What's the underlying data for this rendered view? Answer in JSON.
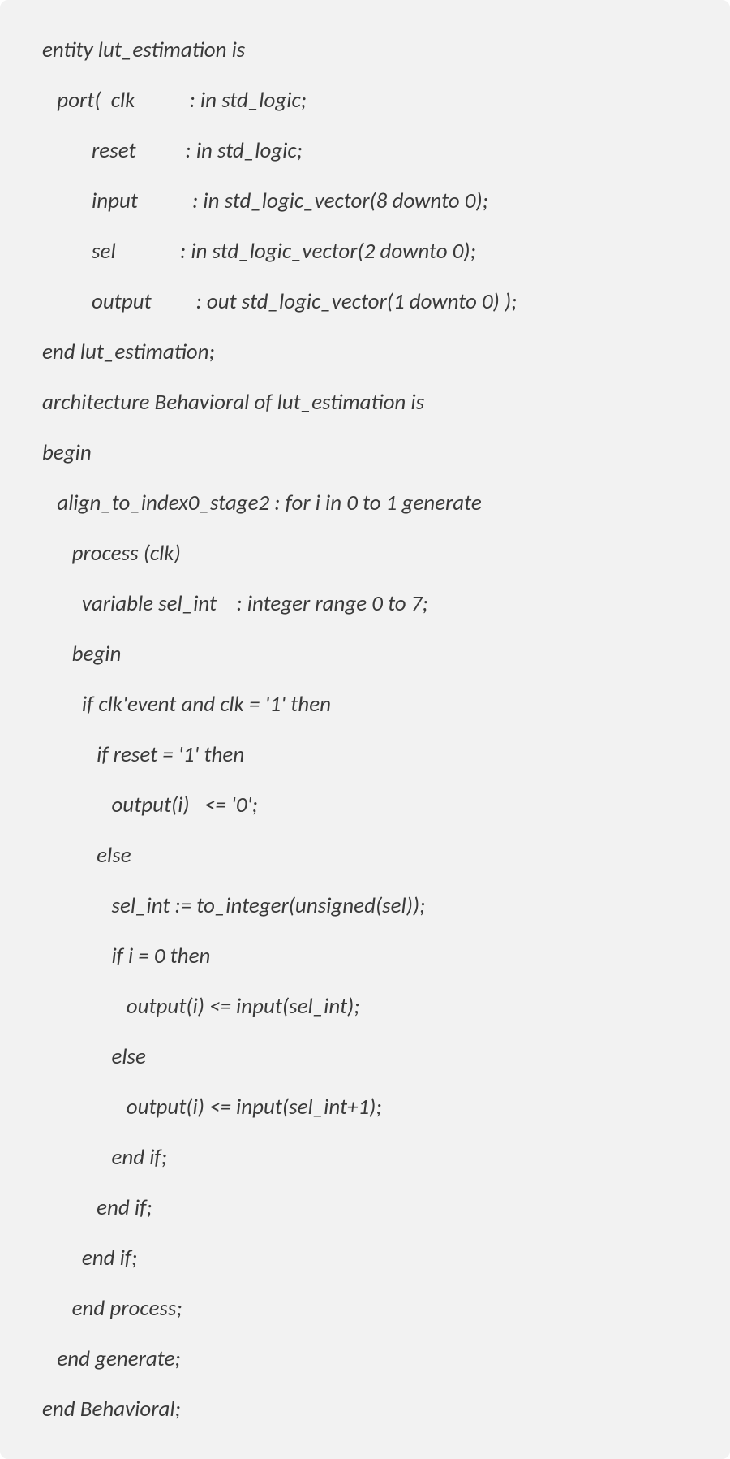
{
  "code": {
    "lines": [
      "entity lut_estimation is",
      "   port(  clk           : in std_logic;",
      "          reset          : in std_logic;",
      "          input           : in std_logic_vector(8 downto 0);",
      "          sel             : in std_logic_vector(2 downto 0);",
      "          output         : out std_logic_vector(1 downto 0) );",
      "end lut_estimation;",
      "architecture Behavioral of lut_estimation is",
      "begin",
      "   align_to_index0_stage2 : for i in 0 to 1 generate",
      "      process (clk)",
      "        variable sel_int    : integer range 0 to 7;",
      "      begin",
      "        if clk'event and clk = '1' then",
      "           if reset = '1' then",
      "              output(i)   <= '0';",
      "           else",
      "              sel_int := to_integer(unsigned(sel));",
      "              if i = 0 then",
      "                 output(i) <= input(sel_int);",
      "              else",
      "                 output(i) <= input(sel_int+1);",
      "              end if;",
      "           end if;",
      "        end if;",
      "      end process;",
      "   end generate;",
      "end Behavioral;"
    ]
  }
}
